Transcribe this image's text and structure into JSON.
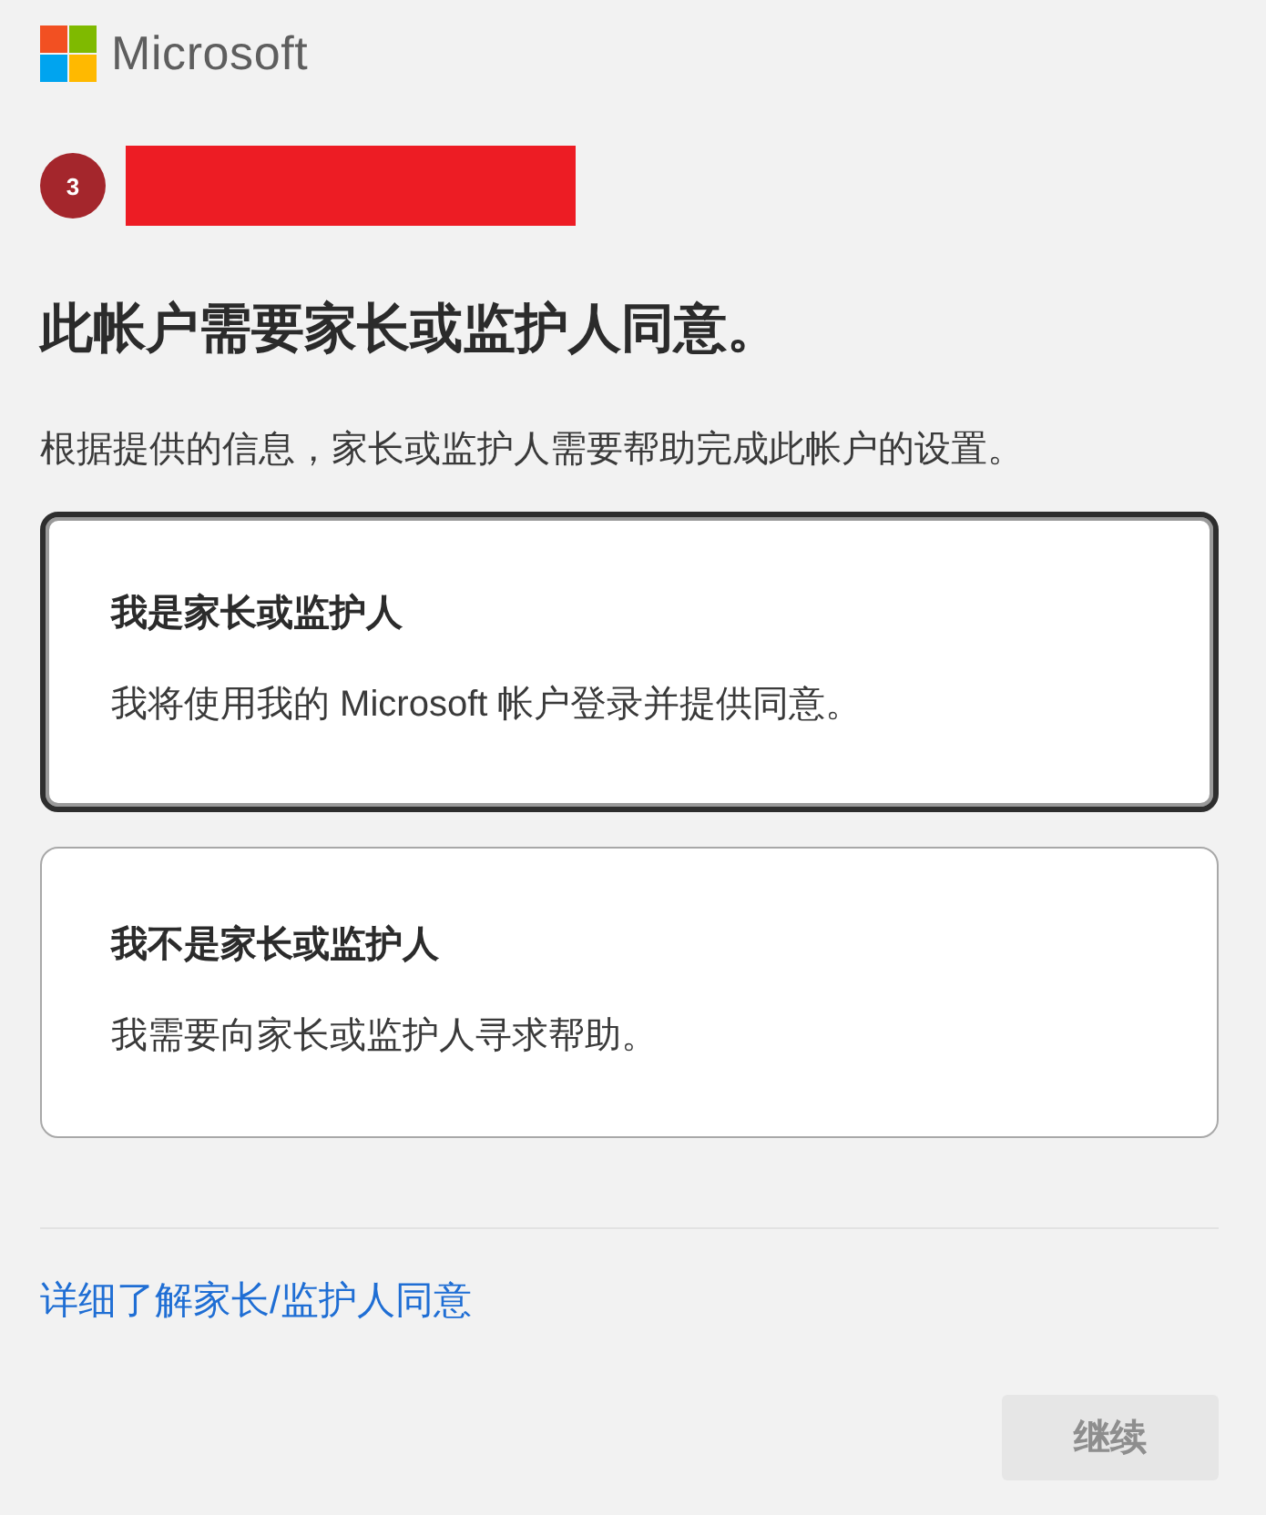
{
  "logo": {
    "text": "Microsoft"
  },
  "step": {
    "number": "3"
  },
  "heading": "此帐户需要家长或监护人同意。",
  "description": "根据提供的信息，家长或监护人需要帮助完成此帐户的设置。",
  "options": [
    {
      "title": "我是家长或监护人",
      "text": "我将使用我的 Microsoft 帐户登录并提供同意。",
      "selected": true
    },
    {
      "title": "我不是家长或监护人",
      "text": "我需要向家长或监护人寻求帮助。",
      "selected": false
    }
  ],
  "link": "详细了解家长/监护人同意",
  "continue_button": {
    "label": "继续",
    "disabled": true
  }
}
